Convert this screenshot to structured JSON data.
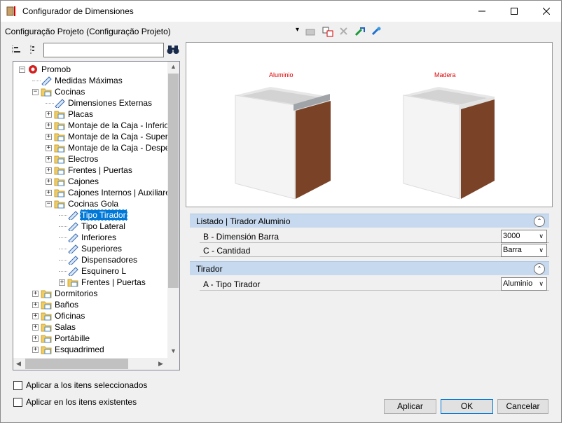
{
  "window": {
    "title": "Configurador de Dimensiones",
    "minimize": "—",
    "maximize": "☐",
    "close": "✕"
  },
  "menubar": {
    "configuration": "Configuração Projeto (Configuração Projeto)",
    "dropdown": "▾"
  },
  "search": {
    "value": "",
    "placeholder": ""
  },
  "tree": {
    "items": [
      {
        "label": "Promob",
        "expander": "−"
      },
      {
        "label": "Medidas Máximas"
      },
      {
        "label": "Cocinas",
        "expander": "−"
      },
      {
        "label": "Dimensiones Externas"
      },
      {
        "label": "Placas",
        "expander": "+"
      },
      {
        "label": "Montaje de la Caja - Inferior",
        "expander": "+"
      },
      {
        "label": "Montaje de la Caja - Superior",
        "expander": "+"
      },
      {
        "label": "Montaje de la Caja - Despens",
        "expander": "+"
      },
      {
        "label": "Electros",
        "expander": "+"
      },
      {
        "label": "Frentes | Puertas",
        "expander": "+"
      },
      {
        "label": "Cajones",
        "expander": "+"
      },
      {
        "label": "Cajones Internos | Auxiliares",
        "expander": "+"
      },
      {
        "label": "Cocinas Gola",
        "expander": "−"
      },
      {
        "label": "Tipo Tirador"
      },
      {
        "label": "Tipo Lateral"
      },
      {
        "label": "Inferiores"
      },
      {
        "label": "Superiores"
      },
      {
        "label": "Dispensadores"
      },
      {
        "label": "Esquinero L"
      },
      {
        "label": "Frentes | Puertas",
        "expander": "+"
      },
      {
        "label": "Dormitorios",
        "expander": "+"
      },
      {
        "label": "Baños",
        "expander": "+"
      },
      {
        "label": "Oficinas",
        "expander": "+"
      },
      {
        "label": "Salas",
        "expander": "+"
      },
      {
        "label": "Portábille",
        "expander": "+"
      },
      {
        "label": "Esquadrimed",
        "expander": "+"
      }
    ]
  },
  "preview": {
    "left_label": "Aluminio",
    "right_label": "Madera"
  },
  "properties": {
    "groups": [
      {
        "title": "Listado | Tirador Aluminio",
        "collapse": "⌃",
        "rows": [
          {
            "label": "B - Dimensión Barra",
            "value": "3000"
          },
          {
            "label": "C - Cantidad",
            "value": "Barra"
          }
        ]
      },
      {
        "title": "Tirador",
        "collapse": "⌃",
        "rows": [
          {
            "label": "A - Tipo Tirador",
            "value": "Aluminio"
          }
        ]
      }
    ]
  },
  "options": {
    "apply_selected": "Aplicar a los itens seleccionados",
    "apply_existing": "Aplicar en los itens existentes"
  },
  "buttons": {
    "apply": "Aplicar",
    "ok": "OK",
    "cancel": "Cancelar"
  },
  "colors": {
    "accent": "#0078d7",
    "label_red": "#e00000",
    "group_header": "#c7d9ee",
    "wood": "#7a4328"
  }
}
